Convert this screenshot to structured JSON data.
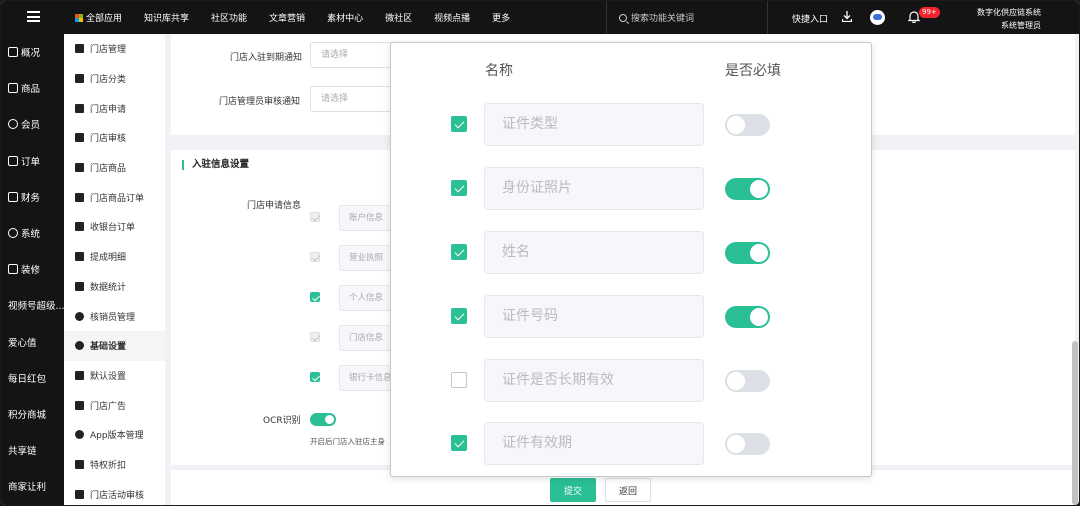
{
  "topbar": {
    "nav": [
      "全部应用",
      "知识库共享",
      "社区功能",
      "文章营销",
      "素材中心",
      "微社区",
      "视频点播",
      "更多"
    ],
    "search_placeholder": "搜索功能关键词",
    "quick_entry": "快捷入口",
    "badge": "99+",
    "org_name": "数字化供应链系统",
    "user_role": "系统管理员"
  },
  "rail": [
    "概况",
    "商品",
    "会员",
    "订单",
    "财务",
    "系统",
    "装修",
    "视频号超级...",
    "爱心值",
    "每日红包",
    "积分商城",
    "共享链",
    "商家让利"
  ],
  "submenu": {
    "items": [
      "门店管理",
      "门店分类",
      "门店申请",
      "门店审核",
      "门店商品",
      "门店商品订单",
      "收银台订单",
      "提成明细",
      "数据统计",
      "核销员管理",
      "基础设置",
      "默认设置",
      "门店广告",
      "App版本管理",
      "特权折扣",
      "门店活动审核"
    ],
    "active": "基础设置"
  },
  "form": {
    "notify_expire_label": "门店入驻到期通知",
    "notify_expire_placeholder": "请选择",
    "notify_audit_label": "门店管理员审核通知",
    "notify_audit_placeholder": "请选择",
    "section_title": "入驻信息设置",
    "apply_info_label": "门店申请信息",
    "apply_items": [
      {
        "label": "账户信息",
        "state": "disabled"
      },
      {
        "label": "营业执照",
        "state": "disabled"
      },
      {
        "label": "个人信息",
        "state": "checked"
      },
      {
        "label": "门店信息",
        "state": "disabled"
      },
      {
        "label": "银行卡信息",
        "state": "checked"
      }
    ],
    "ocr_label": "OCR识别",
    "ocr_enabled": true,
    "ocr_help": "开启后门店入驻店主身",
    "submit": "提交",
    "back": "返回"
  },
  "modal": {
    "col_name": "名称",
    "col_required": "是否必填",
    "rows": [
      {
        "name": "证件类型",
        "checked": true,
        "required": false
      },
      {
        "name": "身份证照片",
        "checked": true,
        "required": true
      },
      {
        "name": "姓名",
        "checked": true,
        "required": true
      },
      {
        "name": "证件号码",
        "checked": true,
        "required": true
      },
      {
        "name": "证件是否长期有效",
        "checked": false,
        "required": false
      },
      {
        "name": "证件有效期",
        "checked": true,
        "required": false
      }
    ]
  },
  "colors": {
    "accent": "#2bbf96",
    "topbar": "#141414"
  }
}
